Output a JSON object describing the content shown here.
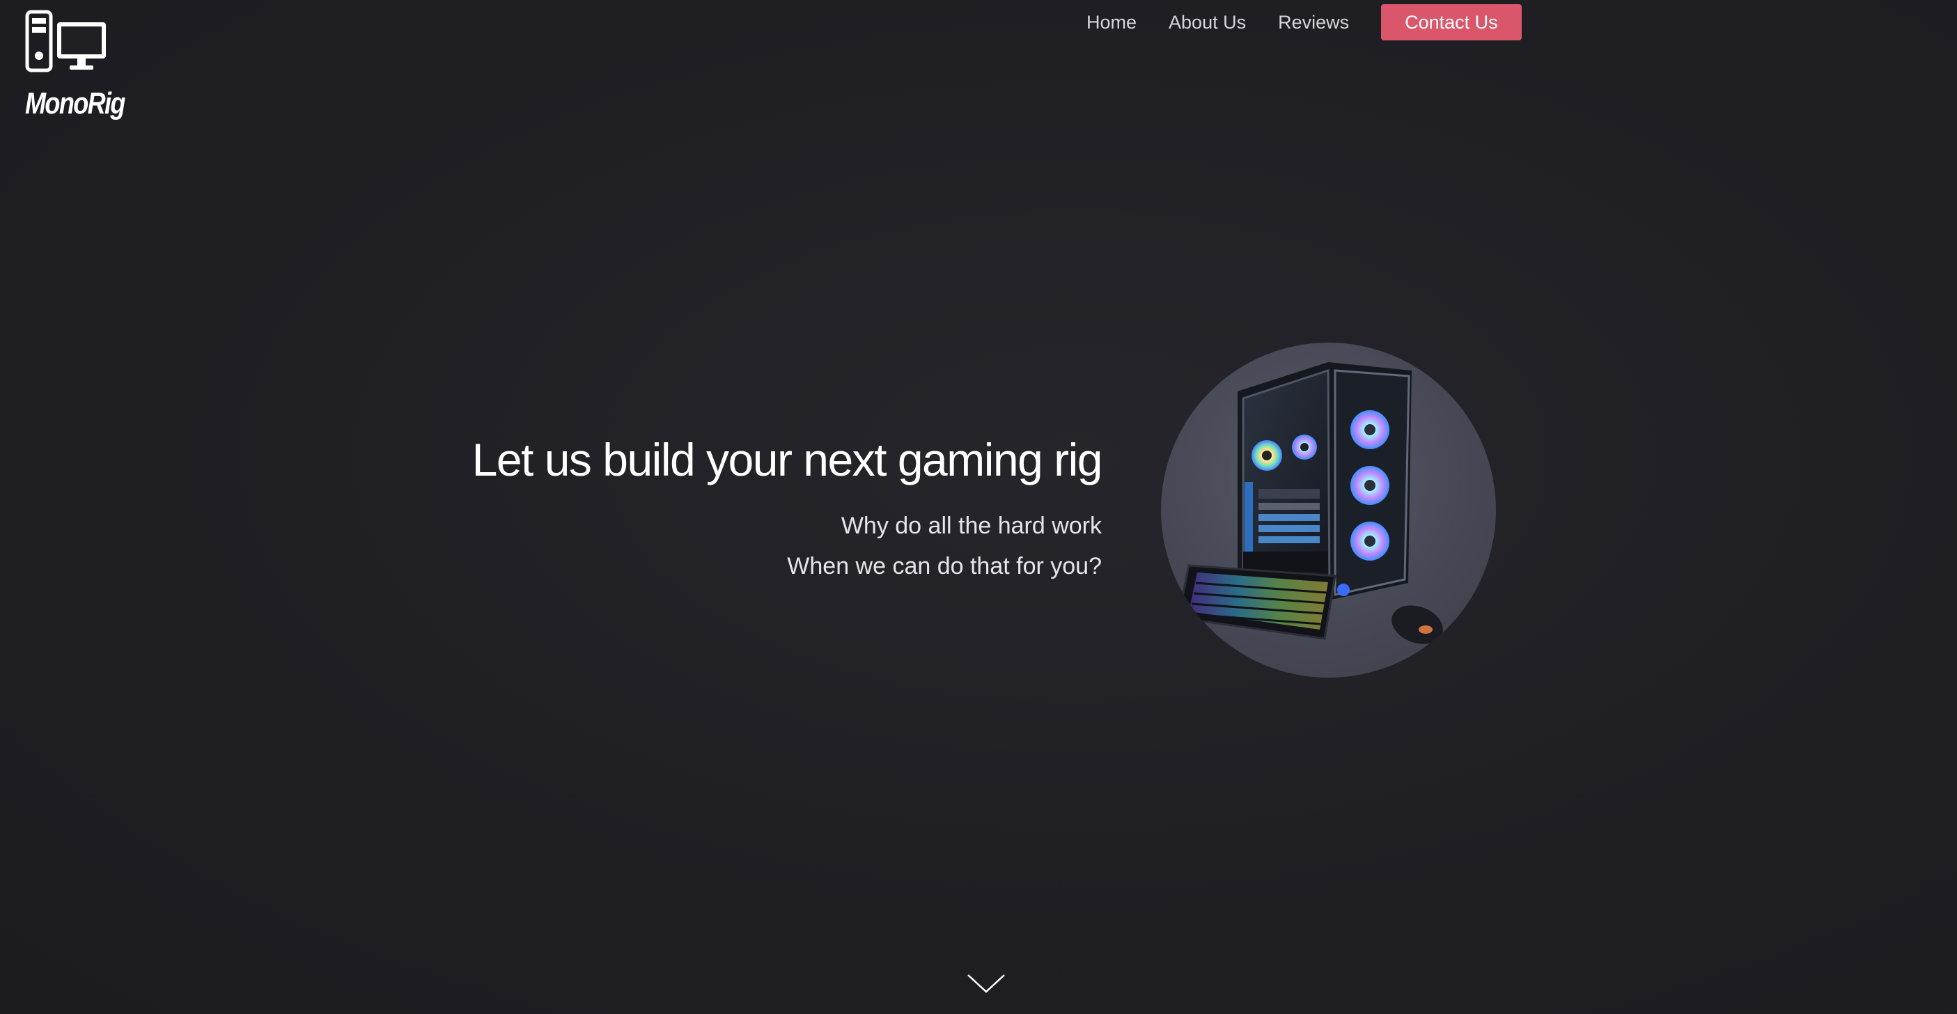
{
  "brand": {
    "name": "MonoRig",
    "logo_icon": "computer-tower-monitor-icon"
  },
  "nav": {
    "links": [
      {
        "label": "Home"
      },
      {
        "label": "About Us"
      },
      {
        "label": "Reviews"
      }
    ],
    "cta_label": "Contact Us"
  },
  "hero": {
    "title": "Let us build your next gaming rig",
    "subtitle_line1": "Why do all the hard work",
    "subtitle_line2": "When we can do that for you?",
    "image_icon": "gaming-pc-setup-image"
  },
  "scroll": {
    "icon": "chevron-down-icon"
  },
  "colors": {
    "background": "#1f1f24",
    "accent": "#d9566b",
    "text": "#ffffff",
    "nav_text": "#d6d6da"
  }
}
